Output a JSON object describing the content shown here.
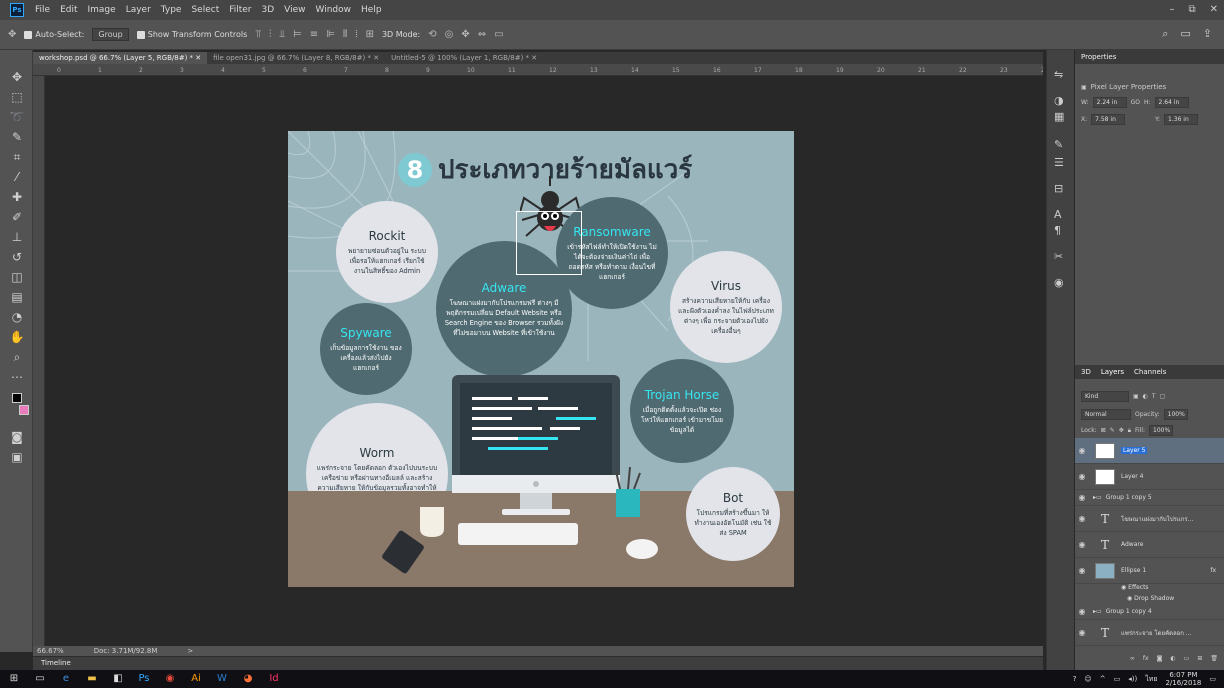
{
  "menubar": {
    "logo": "Ps",
    "items": [
      "File",
      "Edit",
      "Image",
      "Layer",
      "Type",
      "Select",
      "Filter",
      "3D",
      "View",
      "Window",
      "Help"
    ],
    "win_buttons": [
      "–",
      "⧉",
      "✕"
    ]
  },
  "options": {
    "auto_select": "Auto-Select:",
    "group_value": "Group",
    "show_transform": "Show Transform Controls",
    "mode_3d": "3D Mode:"
  },
  "tabs": [
    {
      "label": "workshop.psd @ 66.7% (Layer 5, RGB/8#) *"
    },
    {
      "label": "file open31.jpg @ 66.7% (Layer 8, RGB/8#) *"
    },
    {
      "label": "Untitled-5 @ 100% (Layer 1, RGB/8#) *"
    }
  ],
  "ruler": {
    "ticks": [
      "0",
      "1",
      "2",
      "3",
      "4",
      "5",
      "6",
      "7",
      "8",
      "9",
      "10",
      "11",
      "12",
      "13",
      "14",
      "15",
      "16",
      "17",
      "18",
      "19",
      "20",
      "21",
      "22",
      "23",
      "24"
    ]
  },
  "artwork": {
    "title_num": "8",
    "title_text": "ประเภทวายร้ายมัลแวร์",
    "bubbles": [
      {
        "title": "Rockit",
        "text": "พยายามซ่อนตัวอยู่ใน ระบบเพื่อรอให้แฮกเกอร์ เรียกใช้งานในสิทธิ์ของ Admin"
      },
      {
        "title": "Adware",
        "text": "โฆษณาแฝงมากับโปรแกรมฟรี ต่างๆ มีพฤติกรรมเปลี่ยน Default Website หรือ Search Engine ของ Browser รวมทั้งฝังที่ไม่ขอมาบน Website ที่เข้าใช้งาน"
      },
      {
        "title": "Ransomware",
        "text": "เข้ารหัสไฟล์ทำให้เปิดใช้งาน ไม่ได้จะต้องจ่ายเงินค่าไถ่ เพื่อถอดรหัส หรือทำตาม เงื่อนไขที่แฮกเกอร์"
      },
      {
        "title": "Virus",
        "text": "สร้างความเสียหายให้กับ เครื่องและฝังตัวเองค่ำลง ในไฟล์ประเภทต่างๆ เพื่อ กระจายตัวเองไปยัง เครื่องอื่นๆ"
      },
      {
        "title": "Spyware",
        "text": "เก็บข้อมูลการใช้งาน ของเครื่องแล้วส่งไปยัง แฮกเกอร์"
      },
      {
        "title": "Trojan Horse",
        "text": "เมื่อถูกติดตั้งแล้วจะเปิด ช่องโหว่ให้แฮกเกอร์ เข้ามาขโมยข้อมูลได้"
      },
      {
        "title": "Worm",
        "text": "แพร่กระจาย โดยคัดลอก ตัวเองไปบนระบบเครือข่าย หรือผ่านทางอีเมลล์ และสร้างความเสียหาย ให้กับข้อมูลรวมทั้งอาจทำให้ ระบบหยุดการทำงาน"
      },
      {
        "title": "Bot",
        "text": "โปรแกรมที่สร้างขึ้นมา ให้ทำงานเองอัตโนมัติ เช่น ใช้ส่ง SPAM"
      }
    ]
  },
  "status": {
    "zoom": "66.67%",
    "doc": "Doc: 3.71M/92.8M",
    "arrow": ">"
  },
  "timeline": {
    "label": "Timeline"
  },
  "properties": {
    "tab": "Properties",
    "title": "Pixel Layer Properties",
    "w_label": "W:",
    "w_value": "2.24 in",
    "h_label": "H:",
    "h_value": "2.64 in",
    "x_label": "X:",
    "x_value": "7.58 in",
    "y_label": "Y:",
    "y_value": "1.36 in",
    "link": "GO"
  },
  "layers_panel": {
    "tabs": [
      "3D",
      "Layers",
      "Channels"
    ],
    "kind": "Kind",
    "blend": "Normal",
    "opacity_label": "Opacity:",
    "opacity_value": "100%",
    "lock_label": "Lock:",
    "fill_label": "Fill:",
    "fill_value": "100%",
    "layers": [
      {
        "name": "Layer 5",
        "kind": "pixel"
      },
      {
        "name": "Layer 4",
        "kind": "pixel"
      },
      {
        "name": "Group 1 copy 5",
        "kind": "group"
      },
      {
        "name": "โฆษณาแฝงมากับโปรแกร...",
        "kind": "text"
      },
      {
        "name": "Adware",
        "kind": "text"
      },
      {
        "name": "Ellipse 1",
        "kind": "shape"
      },
      {
        "name": "Effects",
        "kind": "effect"
      },
      {
        "name": "Drop Shadow",
        "kind": "effect"
      },
      {
        "name": "Group 1 copy 4",
        "kind": "group"
      },
      {
        "name": "แพร่กระจาย โดยคัดลอก ...",
        "kind": "text"
      }
    ]
  },
  "taskbar": {
    "icons": [
      "windows-icon",
      "task-view-icon",
      "edge-icon",
      "file-explorer-icon",
      "store-icon",
      "photoshop-icon",
      "chrome-icon",
      "illustrator-icon",
      "word-icon",
      "firefox-icon",
      "indesign-icon"
    ],
    "time": "6:07 PM",
    "date": "2/16/2018",
    "lang": "ไทย"
  }
}
